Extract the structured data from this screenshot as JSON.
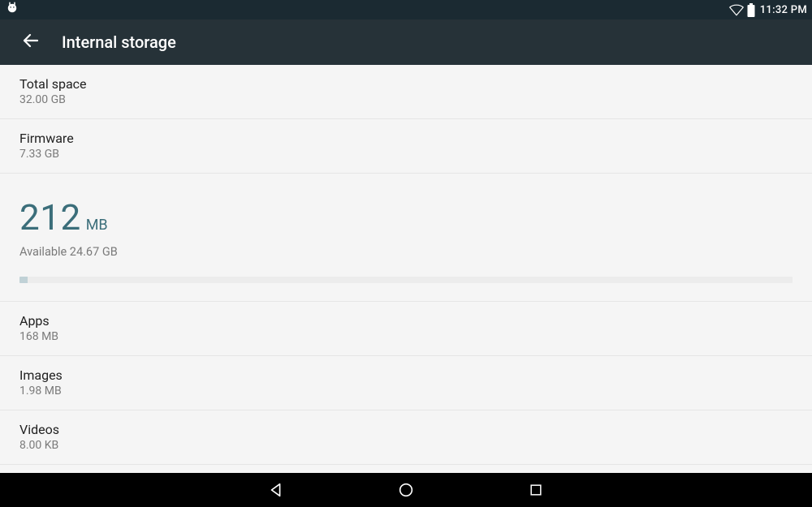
{
  "status": {
    "time": "11:32 PM"
  },
  "header": {
    "title": "Internal storage"
  },
  "total": {
    "label": "Total space",
    "value": "32.00 GB"
  },
  "firmware": {
    "label": "Firmware",
    "value": "7.33 GB"
  },
  "summary": {
    "used_value": "212",
    "used_unit": "MB",
    "available": "Available 24.67 GB"
  },
  "categories": [
    {
      "label": "Apps",
      "value": "168 MB"
    },
    {
      "label": "Images",
      "value": "1.98 MB"
    },
    {
      "label": "Videos",
      "value": "8.00 KB"
    }
  ]
}
